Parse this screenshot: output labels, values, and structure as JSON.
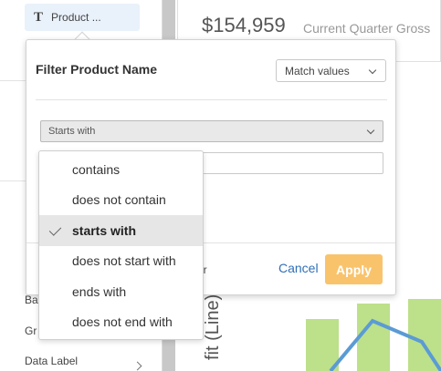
{
  "sidebar": {
    "field": {
      "icon": "text-type-icon",
      "icon_glyph": "T",
      "label": "Product ..."
    },
    "labels": [
      "Ba",
      "Gr",
      "Data Label"
    ]
  },
  "kpi": {
    "value": "$154,959",
    "caption": "Current Quarter Gross"
  },
  "chart": {
    "axis_title": "fit (Line)",
    "bar_color": "#bde08a",
    "line_color": "#5b9bd5"
  },
  "filter": {
    "title": "Filter Product Name",
    "match_mode": "Match values",
    "operator": "Starts with",
    "value": "",
    "footer_partial": "er",
    "cancel_label": "Cancel",
    "apply_label": "Apply",
    "apply_color": "#f9c36c"
  },
  "operator_menu": {
    "items": [
      "contains",
      "does not contain",
      "starts with",
      "does not start with",
      "ends with",
      "does not end with"
    ],
    "selected": "starts with"
  }
}
